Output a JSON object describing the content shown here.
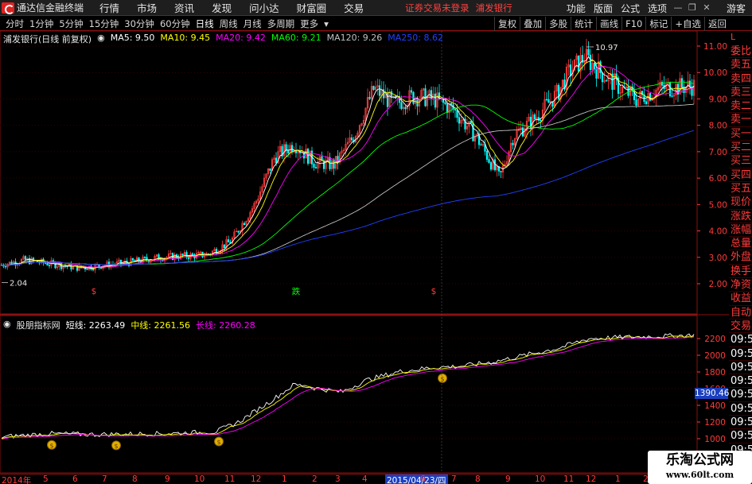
{
  "app": {
    "title": "通达信金融终端"
  },
  "menu": [
    "行情",
    "市场",
    "资讯",
    "发现",
    "问小达",
    "财富圈",
    "交易"
  ],
  "notice": {
    "trade_status": "证券交易未登录",
    "stock": "浦发银行"
  },
  "top_right": {
    "items": [
      "功能",
      "版面",
      "公式",
      "选项"
    ],
    "guest": "游客"
  },
  "periods": [
    {
      "label": "分时"
    },
    {
      "label": "1分钟"
    },
    {
      "label": "5分钟"
    },
    {
      "label": "15分钟"
    },
    {
      "label": "30分钟"
    },
    {
      "label": "60分钟"
    },
    {
      "label": "日线",
      "active": true
    },
    {
      "label": "周线"
    },
    {
      "label": "月线"
    },
    {
      "label": "多周期"
    },
    {
      "label": "更多"
    }
  ],
  "toolbar_buttons": [
    "复权",
    "叠加",
    "多股",
    "统计",
    "画线",
    "F10",
    "标记",
    "+自选",
    "返回"
  ],
  "main_legend": {
    "title": "浦发银行(日线 前复权)",
    "ma": [
      {
        "label": "MA5: 9.50",
        "color": "#ffffff"
      },
      {
        "label": "MA10: 9.45",
        "color": "#ffff00"
      },
      {
        "label": "MA20: 9.42",
        "color": "#ff00ff"
      },
      {
        "label": "MA60: 9.21",
        "color": "#00ff00"
      },
      {
        "label": "MA120: 9.26",
        "color": "#c0c0c0"
      },
      {
        "label": "MA250: 8.62",
        "color": "#2040ff"
      }
    ]
  },
  "indicator_legend": {
    "title": "股朋指标网",
    "lines": [
      {
        "label": "短线: 2263.49",
        "color": "#ffffff"
      },
      {
        "label": "中线: 2261.56",
        "color": "#ffff00"
      },
      {
        "label": "长线: 2260.28",
        "color": "#ff00ff"
      }
    ]
  },
  "main_axis": [
    "11.00",
    "10.00",
    "9.00",
    "8.00",
    "7.00",
    "6.00",
    "5.00",
    "4.00",
    "3.00",
    "2.00"
  ],
  "ind_axis": [
    "2200",
    "2000",
    "1800",
    "1600",
    "1400",
    "1200",
    "1000"
  ],
  "annotations": {
    "high": "10.97",
    "low": "2.04",
    "marker_fall": "跌",
    "marker_s": "$"
  },
  "side_panel": {
    "corner": "L",
    "items": [
      "委比",
      "卖五",
      "卖四",
      "卖三",
      "卖二",
      "卖一",
      "买一",
      "买二",
      "买三",
      "买四",
      "买五",
      "现价",
      "涨跌",
      "涨幅",
      "总量",
      "外盘",
      "换手",
      "净资",
      "收益",
      "自动",
      "交易",
      "09:57",
      "09:57",
      "09:57",
      "09:57",
      "09:57",
      "09:57",
      "09:58",
      "09:58",
      "09:58",
      "09:58"
    ]
  },
  "price_tag": "1390.46",
  "date_axis": {
    "ticks": [
      "2014年",
      "5",
      "6",
      "7",
      "8",
      "9",
      "10",
      "11",
      "12",
      "1",
      "2",
      "3",
      "4",
      "5",
      "6",
      "7",
      "8",
      "9",
      "10",
      "11",
      "12",
      "1",
      "2",
      "3"
    ],
    "highlight": "2015/04/23/四"
  },
  "watermark": {
    "title": "乐淘公式网",
    "url": "www.60lt.com"
  },
  "colors": {
    "up": "#ff3b3b",
    "down": "#00ffff",
    "grid": "#8a1010",
    "ma250": "#2040ff"
  }
}
